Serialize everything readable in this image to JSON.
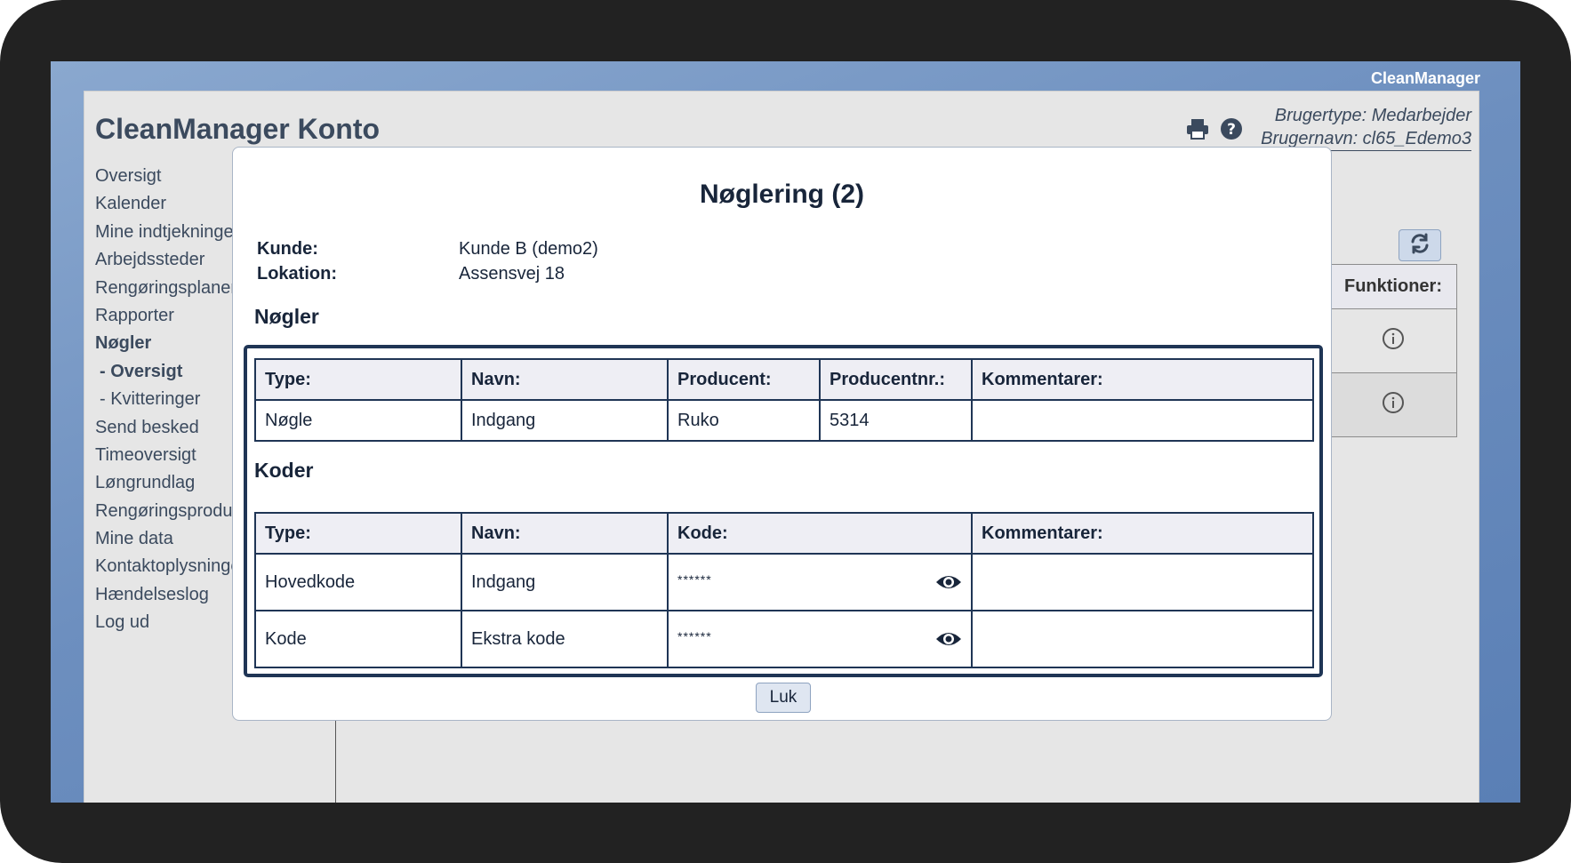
{
  "app": {
    "brand": "CleanManager",
    "title": "CleanManager Konto"
  },
  "user": {
    "type": "Brugertype: Medarbejder",
    "name": "Brugernavn: cl65_Edemo3"
  },
  "nav": {
    "items": [
      {
        "label": "Oversigt"
      },
      {
        "label": "Kalender"
      },
      {
        "label": "Mine indtjekninger"
      },
      {
        "label": "Arbejdssteder"
      },
      {
        "label": "Rengøringsplaner"
      },
      {
        "label": "Rapporter"
      },
      {
        "label": "Nøgler"
      },
      {
        "label": "- Oversigt"
      },
      {
        "label": "- Kvitteringer"
      },
      {
        "label": "Send besked"
      },
      {
        "label": "Timeoversigt"
      },
      {
        "label": "Løngrundlag"
      },
      {
        "label": "Rengøringsprodukter"
      },
      {
        "label": "Mine data"
      },
      {
        "label": "Kontaktoplysninger"
      },
      {
        "label": "Hændelseslog"
      },
      {
        "label": "Log ud"
      }
    ]
  },
  "background_table": {
    "header": "Funktioner:"
  },
  "icons": {
    "print": "printer-icon",
    "help": "question-circle-icon",
    "refresh": "refresh-icon",
    "info": "info-circle-icon",
    "eye": "eye-icon"
  },
  "modal": {
    "title": "Nøglering (2)",
    "customer_label": "Kunde:",
    "customer_value": "Kunde B (demo2)",
    "location_label": "Lokation:",
    "location_value": "Assensvej 18",
    "keys_title": "Nøgler",
    "keys_headers": [
      "Type:",
      "Navn:",
      "Producent:",
      "Producentnr.:",
      "Kommentarer:"
    ],
    "keys_rows": [
      [
        "Nøgle",
        "Indgang",
        "Ruko",
        "5314",
        ""
      ]
    ],
    "codes_title": "Koder",
    "codes_headers": [
      "Type:",
      "Navn:",
      "Kode:",
      "Kommentarer:"
    ],
    "codes_rows": [
      [
        "Hovedkode",
        "Indgang",
        "******",
        ""
      ],
      [
        "Kode",
        "Ekstra kode",
        "******",
        ""
      ]
    ],
    "close_label": "Luk"
  },
  "colors": {
    "accent": "#1f3555",
    "text": "#18253a",
    "nav_text": "#3b4a5e",
    "screen_bg": "#6d8fbf"
  }
}
